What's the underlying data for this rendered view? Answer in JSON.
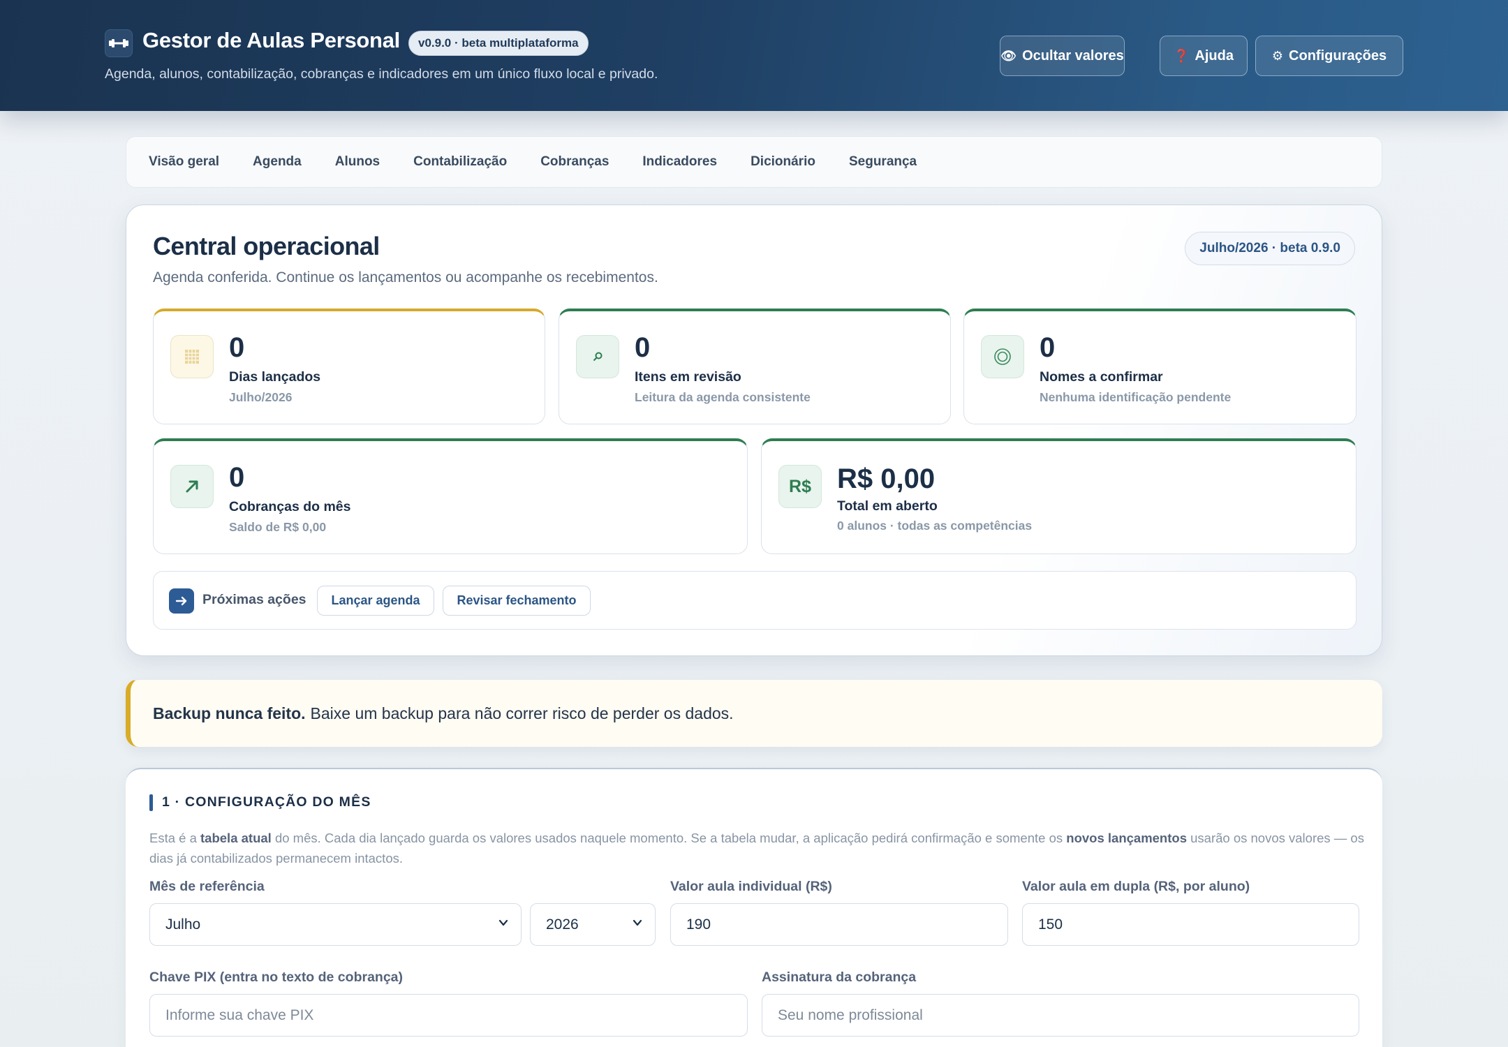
{
  "header": {
    "title": "Gestor de Aulas Personal",
    "version": "v0.9.0 · beta multiplataforma",
    "subtitle": "Agenda, alunos, contabilização, cobranças e indicadores em um único fluxo local e privado.",
    "buttons": {
      "hide_values": "Ocultar valores",
      "help": "Ajuda",
      "settings": "Configurações"
    }
  },
  "nav": {
    "items": [
      "Visão geral",
      "Agenda",
      "Alunos",
      "Contabilização",
      "Cobranças",
      "Indicadores",
      "Dicionário",
      "Segurança"
    ]
  },
  "central": {
    "title": "Central operacional",
    "subtitle": "Agenda conferida. Continue os lançamentos ou acompanhe os recebimentos.",
    "period_badge": "Julho/2026 · beta 0.9.0",
    "metrics": [
      {
        "value": "0",
        "label": "Dias lançados",
        "sub": "Julho/2026",
        "icon": "calendar-icon"
      },
      {
        "value": "0",
        "label": "Itens em revisão",
        "sub": "Leitura da agenda consistente",
        "icon": "search-icon"
      },
      {
        "value": "0",
        "label": "Nomes a confirmar",
        "sub": "Nenhuma identificação pendente",
        "icon": "target-icon"
      },
      {
        "value": "0",
        "label": "Cobranças do mês",
        "sub": "Saldo de R$ 0,00",
        "icon": "trend-up-icon"
      },
      {
        "value": "R$ 0,00",
        "label": "Total em aberto",
        "sub": "0 alunos · todas as competências",
        "icon_text": "R$"
      }
    ],
    "next_actions": {
      "label": "Próximas ações",
      "launch": "Lançar agenda",
      "review": "Revisar fechamento"
    }
  },
  "alert": {
    "bold": "Backup nunca feito.",
    "text": "Baixe um backup para não correr risco de perder os dados."
  },
  "config": {
    "title": "1 · CONFIGURAÇÃO DO MÊS",
    "help_1": "Esta é a ",
    "help_b1": "tabela atual",
    "help_2": " do mês. Cada dia lançado guarda os valores usados naquele momento. Se a tabela mudar, a aplicação pedirá confirmação e somente os ",
    "help_b2": "novos lançamentos",
    "help_3": " usarão os novos valores — os dias já contabilizados permanecem intactos.",
    "month_label": "Mês de referência",
    "month_value": "Julho",
    "year_value": "2026",
    "individual_label": "Valor aula individual (R$)",
    "individual_value": "190",
    "double_label": "Valor aula em dupla (R$, por aluno)",
    "double_value": "150",
    "pix_label": "Chave PIX (entra no texto de cobrança)",
    "pix_placeholder": "Informe sua chave PIX",
    "signature_label": "Assinatura da cobrança",
    "signature_placeholder": "Seu nome profissional"
  }
}
